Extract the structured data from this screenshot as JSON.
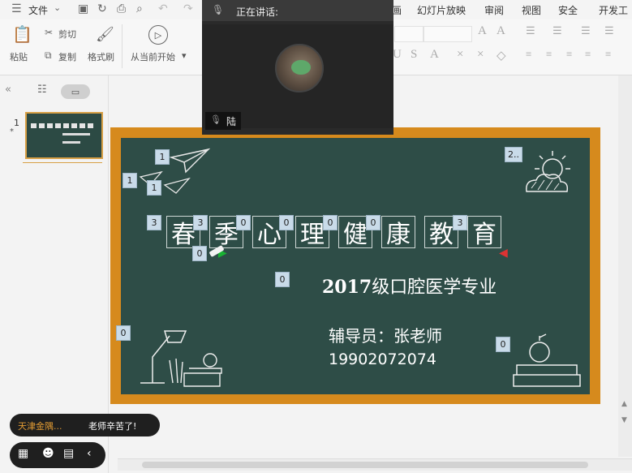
{
  "menubar": {
    "file_label": "文件",
    "tabs": [
      "幻灯片放映",
      "审阅",
      "视图",
      "安全",
      "开发工"
    ]
  },
  "ribbon": {
    "paste_label": "粘贴",
    "cut_label": "剪切",
    "copy_label": "复制",
    "format_painter_label": "格式刷",
    "play_from_current_label": "从当前开始"
  },
  "slide_panel": {
    "slide_number": "1",
    "star": "*"
  },
  "video": {
    "speaking_label": "正在讲话:",
    "speaker_name": "陆"
  },
  "slide": {
    "title_chars": [
      "春",
      "季",
      "心",
      "理",
      "健",
      "康",
      "教",
      "育"
    ],
    "year": "2017",
    "major": "级口腔医学专业",
    "counselor": "辅导员：张老师",
    "phone": "19902072074",
    "tags": {
      "plane1": "1",
      "plane2": "1",
      "plane3": "1",
      "sun": "2..",
      "t1": "3",
      "t2": "3",
      "t3": "0",
      "t4": "0",
      "t5": "0",
      "t6": "0",
      "t7": "3",
      "pen": "0",
      "mid": "0",
      "lamp": "0",
      "books": "0"
    }
  },
  "chat": {
    "sender": "天津金隅...",
    "message": "老师辛苦了!"
  }
}
